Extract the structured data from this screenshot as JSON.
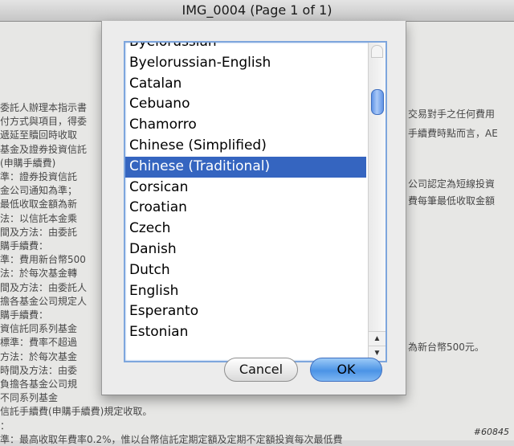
{
  "window": {
    "title": "IMG_0004 (Page 1 of 1)"
  },
  "document": {
    "left_lines": [
      "委託人辦理本指示書",
      "付方式與項目，得委",
      "遞延至贖回時收取",
      "基金及證券投資信託",
      "(申購手續費)",
      "準：證券投資信託",
      "金公司通知為準；",
      "最低收取金額為新",
      "法：以信託本金乘",
      "間及方法：由委託",
      "購手續費：",
      "準：費用新台幣500",
      "法：於每次基金轉",
      "間及方法：由委託人",
      "擔各基金公司規定人",
      "購手續費：",
      "資信託同系列基金",
      "標準：費率不超過",
      "方法：於每次基金",
      "時間及方法：由委",
      "負擔各基金公司規",
      "不同系列基金",
      "信託手續費(申購手續費)規定收取。",
      "：",
      "準：最高收取年費率0.2%，惟以台幣信託定期定額及定期不定額投資每次最低費"
    ],
    "right_lines": [
      "交易對手之任何費用",
      "手續費時點而言，AE",
      "公司認定為短線投資",
      "費每筆最低收取金額",
      "為新台幣500元。"
    ],
    "watermark": "#60845"
  },
  "dialog": {
    "languages": [
      "Byelorussian",
      "Byelorussian-English",
      "Catalan",
      "Cebuano",
      "Chamorro",
      "Chinese (Simplified)",
      "Chinese (Traditional)",
      "Corsican",
      "Croatian",
      "Czech",
      "Danish",
      "Dutch",
      "English",
      "Esperanto",
      "Estonian"
    ],
    "selected": "Chinese (Traditional)",
    "cancel_label": "Cancel",
    "ok_label": "OK"
  }
}
